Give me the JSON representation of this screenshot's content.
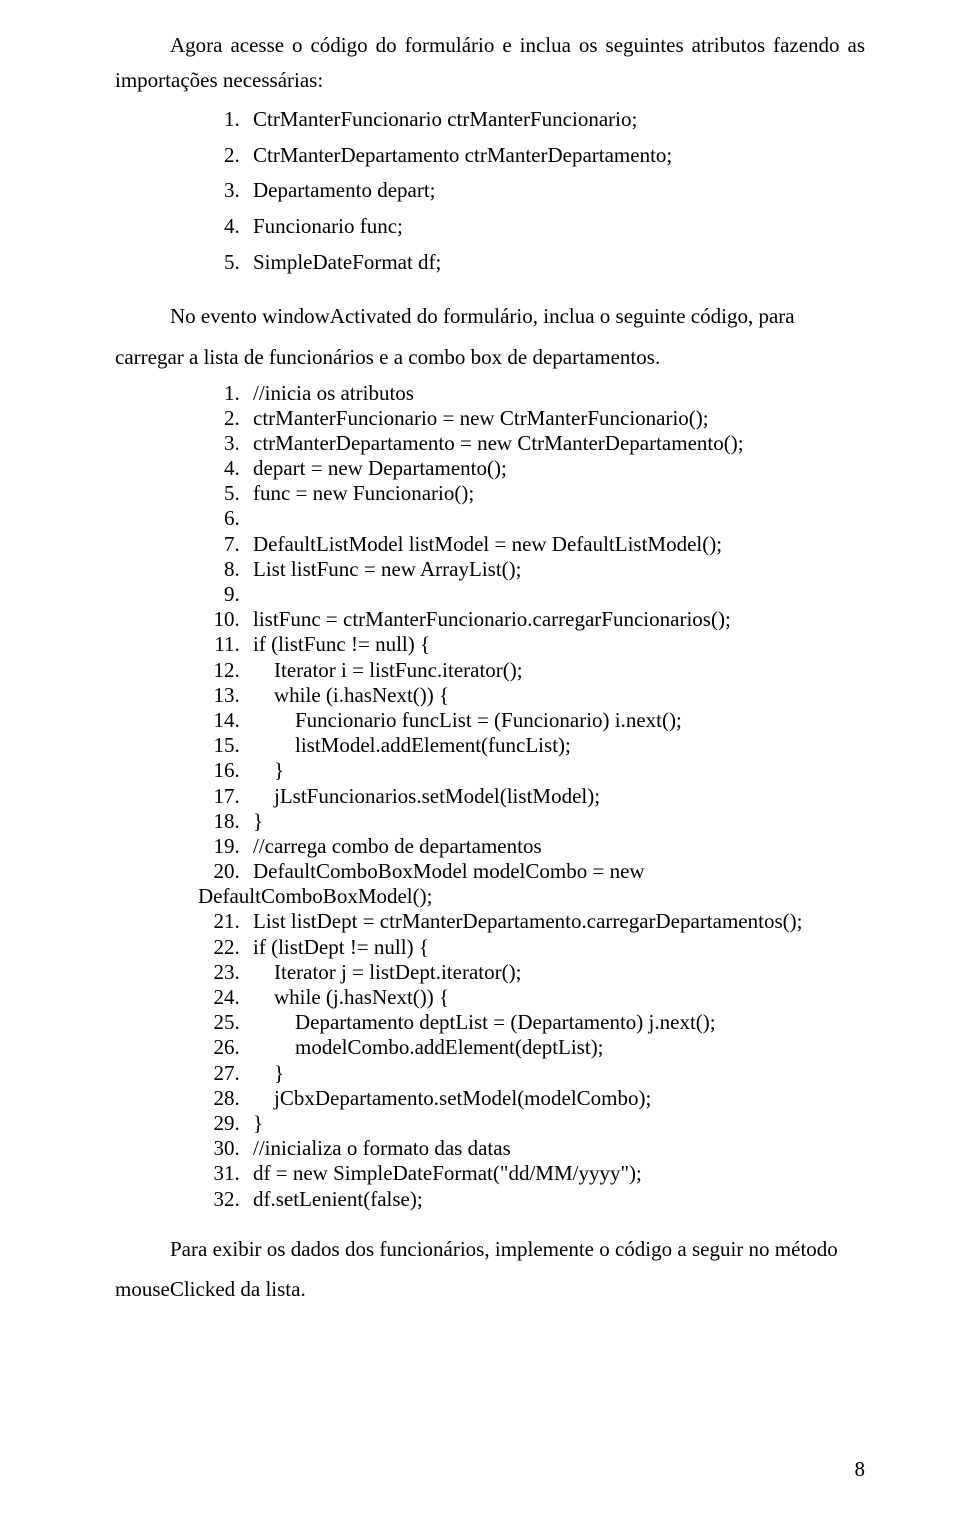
{
  "intro": {
    "line1": "Agora acesse o código do formulário e inclua os seguintes atributos fazendo as importações",
    "line2": "necessárias:"
  },
  "attrs": [
    "CtrManterFuncionario ctrManterFuncionario;",
    "CtrManterDepartamento ctrManterDepartamento;",
    "Departamento depart;",
    "Funcionario func;",
    "SimpleDateFormat df;"
  ],
  "eventoIntro": {
    "line1": "No evento windowActivated do formulário, inclua o seguinte código, para",
    "line2": "carregar a lista de funcionários e a combo box de departamentos."
  },
  "code": [
    "//inicia os atributos",
    "ctrManterFuncionario = new CtrManterFuncionario();",
    "ctrManterDepartamento = new CtrManterDepartamento();",
    "depart = new Departamento();",
    "func = new Funcionario();",
    "",
    "DefaultListModel listModel = new DefaultListModel();",
    "List listFunc = new ArrayList();",
    "",
    "listFunc = ctrManterFuncionario.carregarFuncionarios();",
    "if (listFunc != null) {",
    "    Iterator i = listFunc.iterator();",
    "    while (i.hasNext()) {",
    "        Funcionario funcList = (Funcionario) i.next();",
    "        listModel.addElement(funcList);",
    "    }",
    "    jLstFuncionarios.setModel(listModel);",
    "}",
    "//carrega combo de departamentos",
    "DefaultComboBoxModel modelCombo = new\nDefaultComboBoxModel();",
    "List listDept = ctrManterDepartamento.carregarDepartamentos();",
    "if (listDept != null) {",
    "    Iterator j = listDept.iterator();",
    "    while (j.hasNext()) {",
    "        Departamento deptList = (Departamento) j.next();",
    "        modelCombo.addElement(deptList);",
    "    }",
    "    jCbxDepartamento.setModel(modelCombo);",
    "}",
    "//inicializa o formato das datas",
    "df = new SimpleDateFormat(\"dd/MM/yyyy\");",
    "df.setLenient(false);"
  ],
  "outro": {
    "line1": "Para exibir os dados dos funcionários, implemente o código a seguir no método",
    "line2": "mouseClicked da lista."
  },
  "pageNumber": "8"
}
